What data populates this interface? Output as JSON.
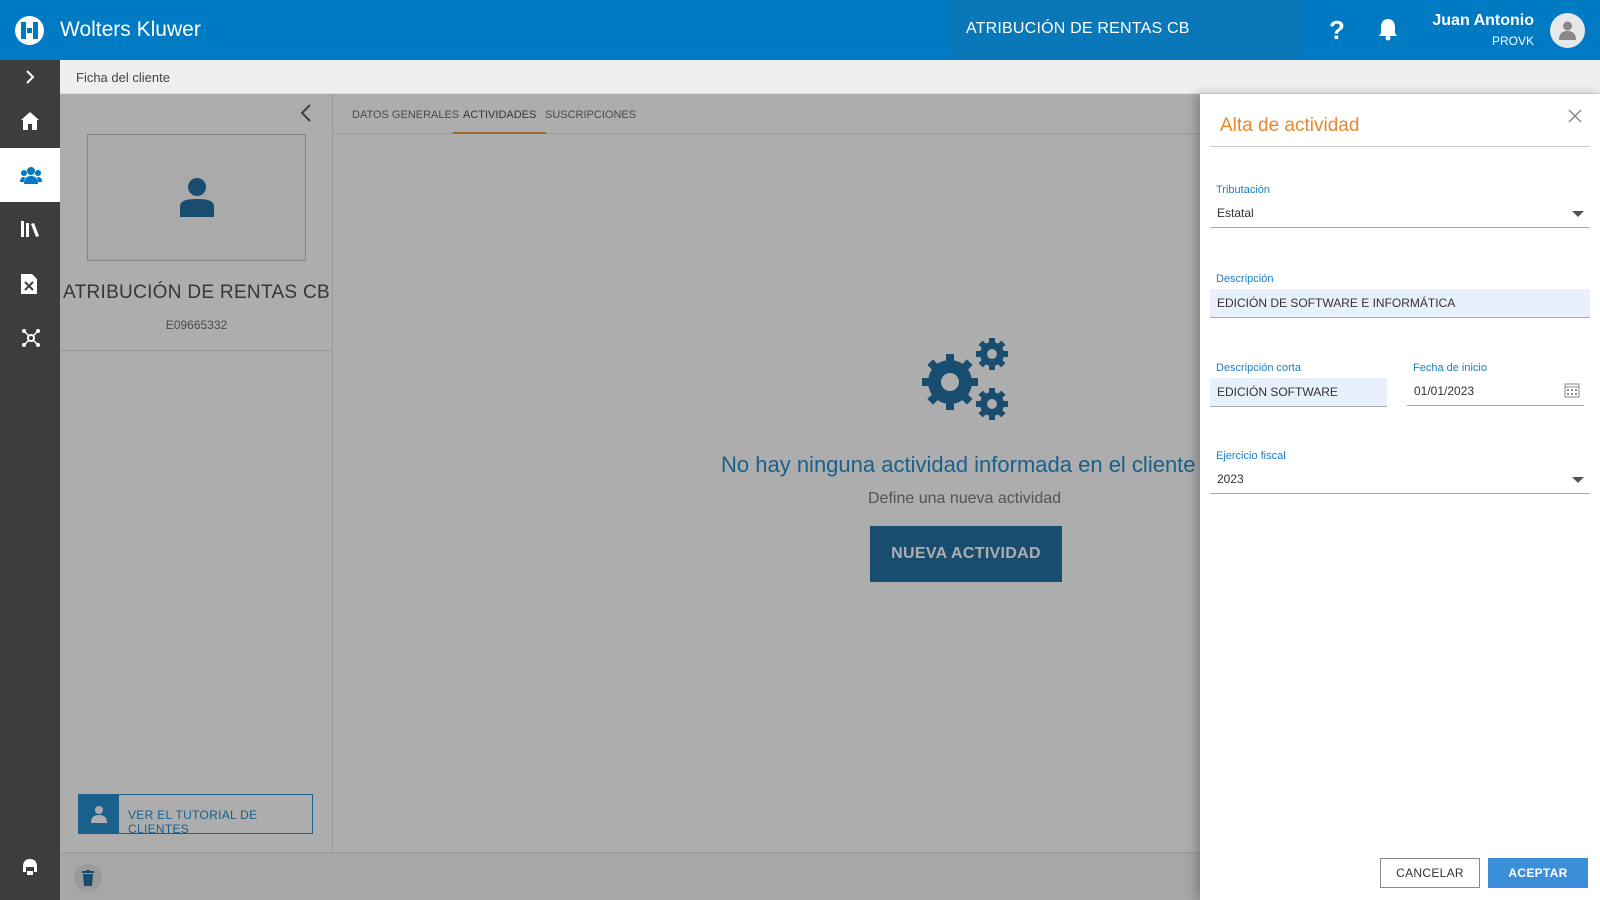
{
  "header": {
    "brand": "Wolters Kluwer",
    "client_title": "ATRIBUCIÓN DE RENTAS CB",
    "help_label": "?",
    "user_name": "Juan Antonio",
    "user_code": "PROVK",
    "accent_color": "#007ac3"
  },
  "sidebar": {
    "items": [
      {
        "icon": "chevron-right-icon"
      },
      {
        "icon": "home-icon"
      },
      {
        "icon": "users-icon",
        "active": true
      },
      {
        "icon": "library-icon"
      },
      {
        "icon": "excel-icon"
      },
      {
        "icon": "network-icon"
      },
      {
        "icon": "support-icon"
      }
    ]
  },
  "breadcrumb": {
    "label": "Ficha del cliente"
  },
  "client": {
    "name": "ATRIBUCIÓN DE RENTAS CB",
    "nif": "E09665332",
    "tutorial_label": "VER EL TUTORIAL DE CLIENTES"
  },
  "tabs": [
    {
      "label": "DATOS GENERALES"
    },
    {
      "label": "ACTIVIDADES",
      "active": true
    },
    {
      "label": "SUSCRIPCIONES"
    }
  ],
  "empty_state": {
    "title": "No hay ninguna actividad informada en el cliente",
    "subtitle": "Define una nueva actividad",
    "button_label": "NUEVA ACTIVIDAD"
  },
  "drawer": {
    "title": "Alta de actividad",
    "fields": {
      "tributacion": {
        "label": "Tributación",
        "value": "Estatal"
      },
      "descripcion": {
        "label": "Descripción",
        "value": "EDICIÓN DE SOFTWARE E INFORMÁTICA"
      },
      "descripcion_corta": {
        "label": "Descripción corta",
        "value": "EDICIÓN SOFTWARE"
      },
      "fecha_inicio": {
        "label": "Fecha de inicio",
        "value": "01/01/2023"
      },
      "ejercicio": {
        "label": "Ejercicio fiscal",
        "value": "2023"
      }
    },
    "cancel_label": "CANCELAR",
    "accept_label": "ACEPTAR",
    "title_color": "#e5892a"
  }
}
